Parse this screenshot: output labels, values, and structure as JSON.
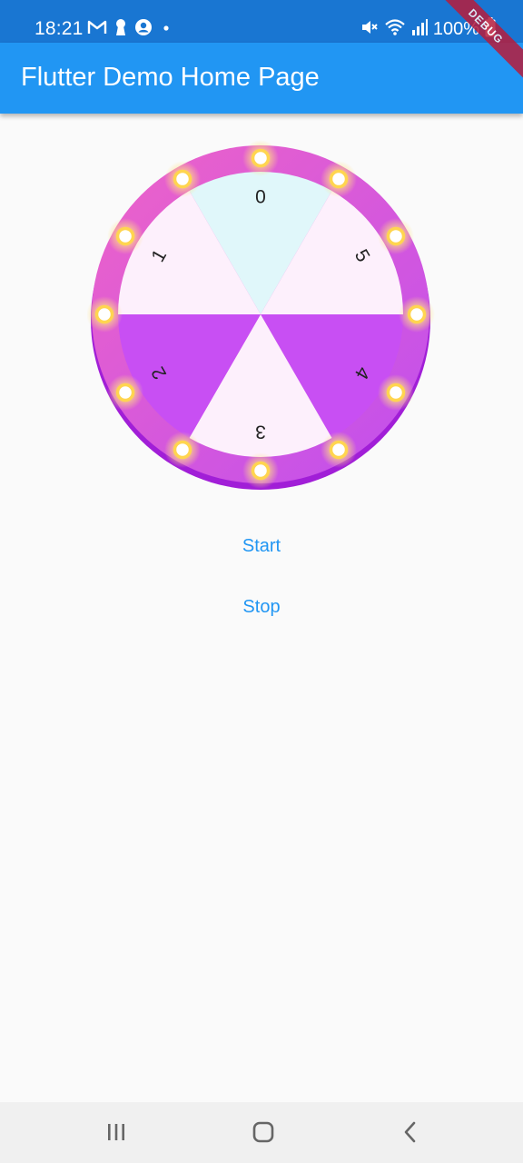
{
  "status_bar": {
    "time": "18:21",
    "battery_text": "100%",
    "icons_left": [
      "gmail-icon",
      "keyhole-icon",
      "account-circle-icon",
      "dot-icon"
    ],
    "icons_right": [
      "mute-icon",
      "wifi-icon",
      "signal-icon",
      "battery-icon"
    ]
  },
  "app_bar": {
    "title": "Flutter Demo Home Page",
    "color": "#2196f3"
  },
  "debug_banner": {
    "label": "DEBUG"
  },
  "wheel": {
    "segments": [
      {
        "label": "0",
        "color": "#e0f7fa"
      },
      {
        "label": "5",
        "color": "#fdf0fc"
      },
      {
        "label": "4",
        "color": "#c84ff3"
      },
      {
        "label": "3",
        "color": "#fdf0fc"
      },
      {
        "label": "2",
        "color": "#c84ff3"
      },
      {
        "label": "1",
        "color": "#fdf0fc"
      }
    ],
    "rim_color": "#d458e8",
    "light_color": "#ffd54f",
    "light_count": 12
  },
  "buttons": {
    "start_label": "Start",
    "stop_label": "Stop",
    "color": "#2196f3"
  },
  "nav_bar": {
    "items": [
      "recent-apps-icon",
      "home-icon",
      "back-icon"
    ]
  }
}
